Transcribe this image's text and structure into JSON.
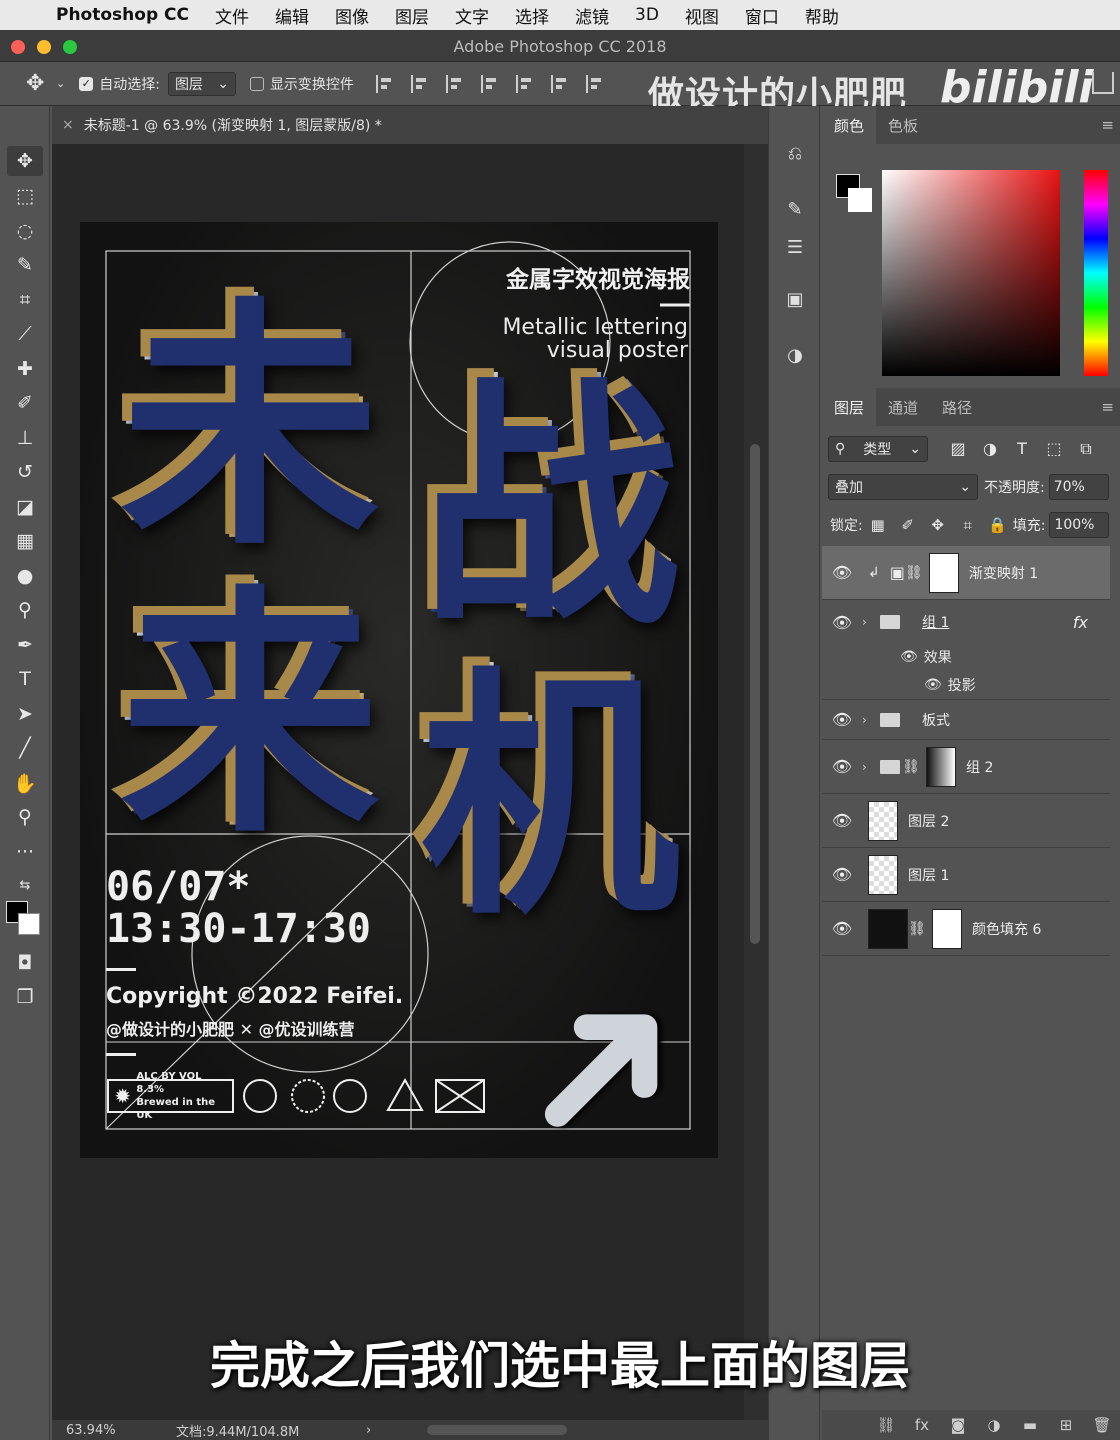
{
  "menubar": {
    "app_name": "Photoshop CC",
    "items": [
      "文件",
      "编辑",
      "图像",
      "图层",
      "文字",
      "选择",
      "滤镜",
      "3D",
      "视图",
      "窗口",
      "帮助"
    ]
  },
  "window": {
    "title": "Adobe Photoshop CC 2018"
  },
  "options_bar": {
    "auto_select_label": "自动选择:",
    "auto_select_value": "图层",
    "show_transform_label": "显示变换控件",
    "watermark": "做设计的小肥肥",
    "bilibili": "bilibili"
  },
  "document": {
    "tab_title": "未标题-1 @ 63.9% (渐变映射 1, 图层蒙版/8) *",
    "zoom": "63.94%",
    "doc_size": "文档:9.44M/104.8M"
  },
  "poster": {
    "heading": "金属字效视觉海报",
    "sub_line1": "Metallic lettering",
    "sub_line2": "visual poster",
    "glyphs": [
      "未",
      "战",
      "来",
      "机"
    ],
    "date_line1": "06/07*",
    "date_line2": "13:30-17:30",
    "copyright": "Copyright ©2022 Feifei.",
    "credit": "@做设计的小肥肥 ✕ @优设训练营",
    "badge_line1": "ALC BY VOL 8.3%",
    "badge_line2": "Brewed in the UK",
    "icons": [
      "globe-icon",
      "get-seal-icon",
      "www-icon",
      "recycle-icon",
      "envelope-icon"
    ]
  },
  "color_panel": {
    "tabs": [
      "颜色",
      "色板"
    ],
    "foreground": "#000000",
    "background": "#ffffff"
  },
  "layers_panel": {
    "tabs": [
      "图层",
      "通道",
      "路径"
    ],
    "filter_label": "类型",
    "blend_mode": "叠加",
    "opacity_label": "不透明度:",
    "opacity_value": "70%",
    "lock_label": "锁定:",
    "fill_label": "填充:",
    "fill_value": "100%",
    "layers": [
      {
        "name": "渐变映射 1",
        "selected": true
      },
      {
        "name": "组 1",
        "fx": "fx",
        "effects_label": "效果",
        "effect_item": "投影"
      },
      {
        "name": "板式"
      },
      {
        "name": "组 2"
      },
      {
        "name": "图层 2"
      },
      {
        "name": "图层 1"
      },
      {
        "name": "颜色填充 6"
      }
    ]
  },
  "subtitle": "完成之后我们选中最上面的图层"
}
